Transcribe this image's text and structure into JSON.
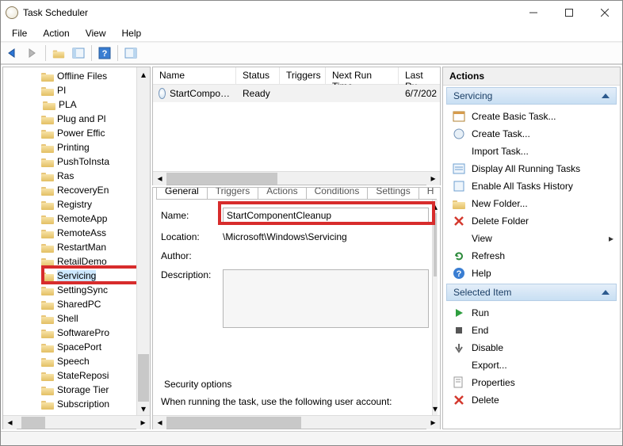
{
  "window": {
    "title": "Task Scheduler"
  },
  "menu": {
    "file": "File",
    "action": "Action",
    "view": "View",
    "help": "Help"
  },
  "tree": {
    "items": [
      {
        "label": "Offline Files"
      },
      {
        "label": "PI"
      },
      {
        "label": "PLA",
        "expandable": true
      },
      {
        "label": "Plug and Pl"
      },
      {
        "label": "Power Effic"
      },
      {
        "label": "Printing"
      },
      {
        "label": "PushToInsta"
      },
      {
        "label": "Ras"
      },
      {
        "label": "RecoveryEn"
      },
      {
        "label": "Registry"
      },
      {
        "label": "RemoteApp"
      },
      {
        "label": "RemoteAss"
      },
      {
        "label": "RestartMan"
      },
      {
        "label": "RetailDemo"
      },
      {
        "label": "Servicing",
        "selected": true
      },
      {
        "label": "SettingSync"
      },
      {
        "label": "SharedPC"
      },
      {
        "label": "Shell"
      },
      {
        "label": "SoftwarePro"
      },
      {
        "label": "SpacePort"
      },
      {
        "label": "Speech"
      },
      {
        "label": "StateReposi"
      },
      {
        "label": "Storage Tier"
      },
      {
        "label": "Subscription"
      }
    ]
  },
  "task_list": {
    "cols": {
      "name": "Name",
      "status": "Status",
      "triggers": "Triggers",
      "next": "Next Run Time",
      "last": "Last Ru"
    },
    "rows": [
      {
        "name": "StartCompo…",
        "status": "Ready",
        "triggers": "",
        "next": "",
        "last": "6/7/202"
      }
    ]
  },
  "tabs": {
    "general": "General",
    "triggers": "Triggers",
    "actions": "Actions",
    "conditions": "Conditions",
    "settings": "Settings",
    "history": "H"
  },
  "general": {
    "name_label": "Name:",
    "name_value": "StartComponentCleanup",
    "location_label": "Location:",
    "location_value": "\\Microsoft\\Windows\\Servicing",
    "author_label": "Author:",
    "desc_label": "Description:",
    "security_label": "Security options",
    "security_text": "When running the task, use the following user account:"
  },
  "actions": {
    "title": "Actions",
    "section1": "Servicing",
    "items1": [
      {
        "icon": "calendar-icon",
        "label": "Create Basic Task..."
      },
      {
        "icon": "task-icon",
        "label": "Create Task..."
      },
      {
        "icon": "blank",
        "label": "Import Task..."
      },
      {
        "icon": "list-icon",
        "label": "Display All Running Tasks"
      },
      {
        "icon": "enable-icon",
        "label": "Enable All Tasks History"
      },
      {
        "icon": "folder-icon",
        "label": "New Folder..."
      },
      {
        "icon": "x-icon",
        "label": "Delete Folder"
      },
      {
        "icon": "blank",
        "label": "View",
        "sub": true
      },
      {
        "icon": "refresh-icon",
        "label": "Refresh"
      },
      {
        "icon": "help-icon",
        "label": "Help"
      }
    ],
    "section2": "Selected Item",
    "items2": [
      {
        "icon": "run-icon",
        "label": "Run"
      },
      {
        "icon": "stop-icon",
        "label": "End"
      },
      {
        "icon": "disable-icon",
        "label": "Disable"
      },
      {
        "icon": "blank",
        "label": "Export..."
      },
      {
        "icon": "props-icon",
        "label": "Properties"
      },
      {
        "icon": "x-icon",
        "label": "Delete"
      }
    ]
  }
}
